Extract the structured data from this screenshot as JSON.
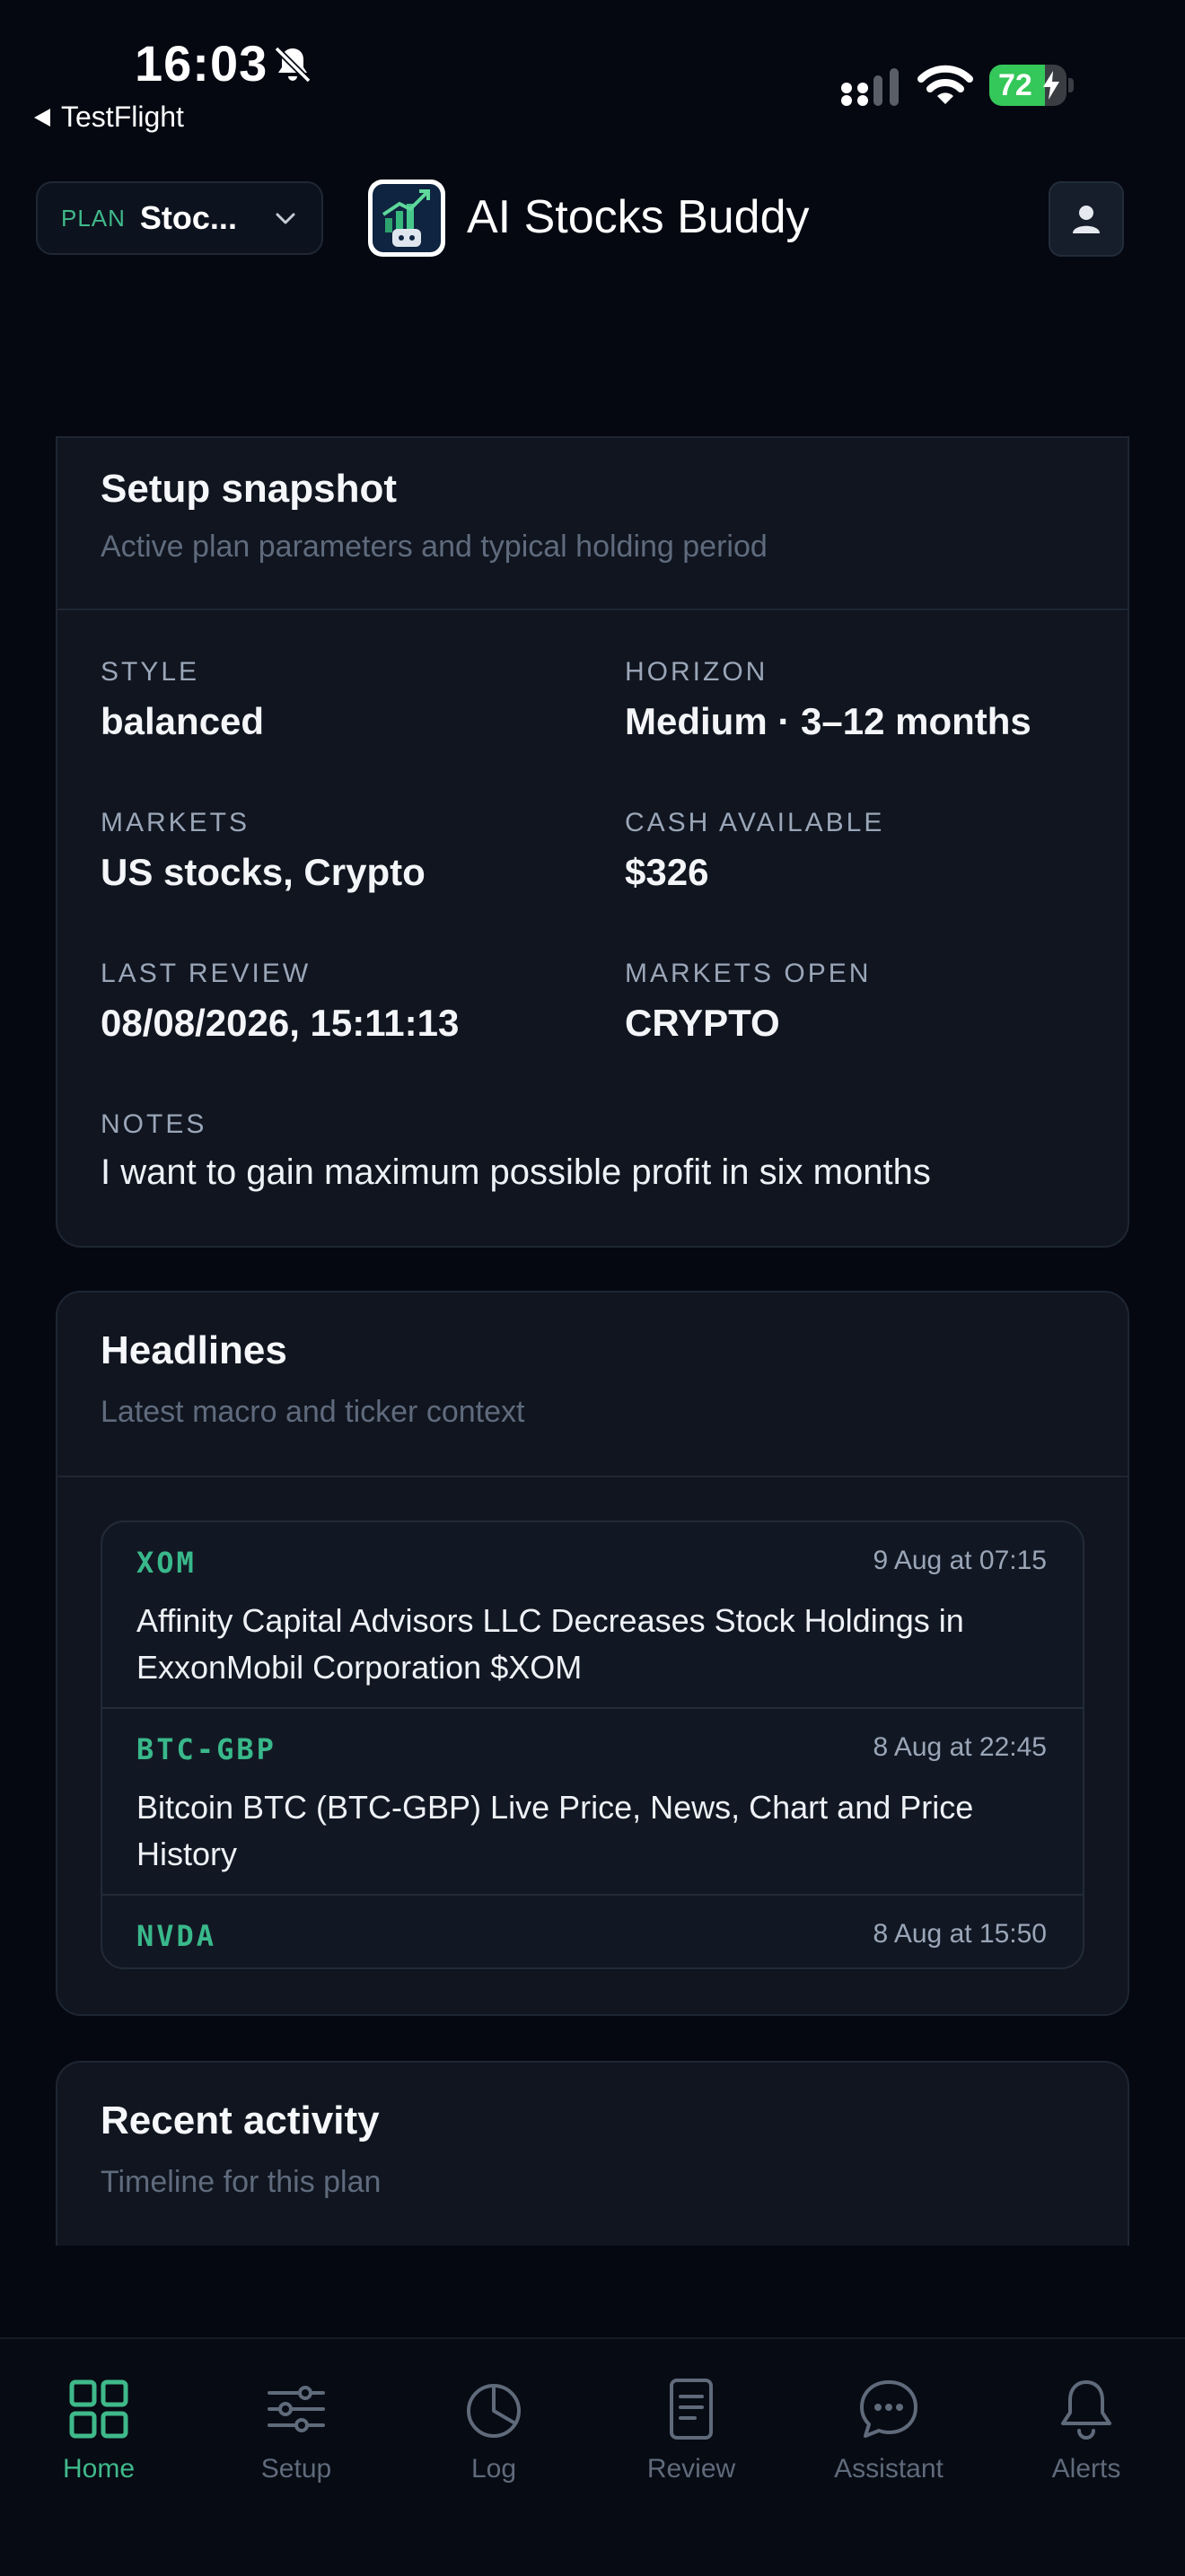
{
  "status_bar": {
    "time": "16:03",
    "back_label": "TestFlight",
    "battery": "72",
    "battery_level": 0.72
  },
  "header": {
    "plan_label": "PLAN",
    "plan_value": "Stoc...",
    "app_title": "AI Stocks Buddy"
  },
  "snapshot": {
    "title": "Setup snapshot",
    "subtitle": "Active plan parameters and typical holding period",
    "style_label": "STYLE",
    "style_value": "balanced",
    "horizon_label": "HORIZON",
    "horizon_value": "Medium · 3–12 months",
    "markets_label": "MARKETS",
    "markets_value": "US stocks, Crypto",
    "cash_label": "CASH AVAILABLE",
    "cash_value": "$326",
    "review_label": "LAST REVIEW",
    "review_value": "08/08/2026, 15:11:13",
    "open_label": "MARKETS OPEN",
    "open_value": "CRYPTO",
    "notes_label": "NOTES",
    "notes_value": "I want to gain maximum possible profit in six months"
  },
  "headlines": {
    "title": "Headlines",
    "subtitle": "Latest macro and ticker context",
    "items": [
      {
        "ticker": "XOM",
        "time": "9 Aug at 07:15",
        "title": "Affinity Capital Advisors LLC Decreases Stock Holdings in ExxonMobil Corporation $XOM"
      },
      {
        "ticker": "BTC-GBP",
        "time": "8 Aug at 22:45",
        "title": "Bitcoin BTC (BTC-GBP) Live Price, News, Chart and Price History"
      },
      {
        "ticker": "NVDA",
        "time": "8 Aug at 15:50",
        "title": ""
      }
    ]
  },
  "activity": {
    "title": "Recent activity",
    "subtitle": "Timeline for this plan"
  },
  "tabs": {
    "home": "Home",
    "setup": "Setup",
    "log": "Log",
    "review": "Review",
    "assistant": "Assistant",
    "alerts": "Alerts"
  },
  "colors": {
    "background": "#050811",
    "card": "#10151f",
    "accent": "#3fb98a",
    "battery": "#34c759"
  },
  "icons": [
    "bell-slash-icon",
    "signal-icon",
    "wifi-icon",
    "battery-icon",
    "chevron-down-icon",
    "robot-chart-logo",
    "user-icon",
    "grid-icon",
    "sliders-icon",
    "pie-icon",
    "document-icon",
    "chat-bubble-icon",
    "bell-icon"
  ]
}
